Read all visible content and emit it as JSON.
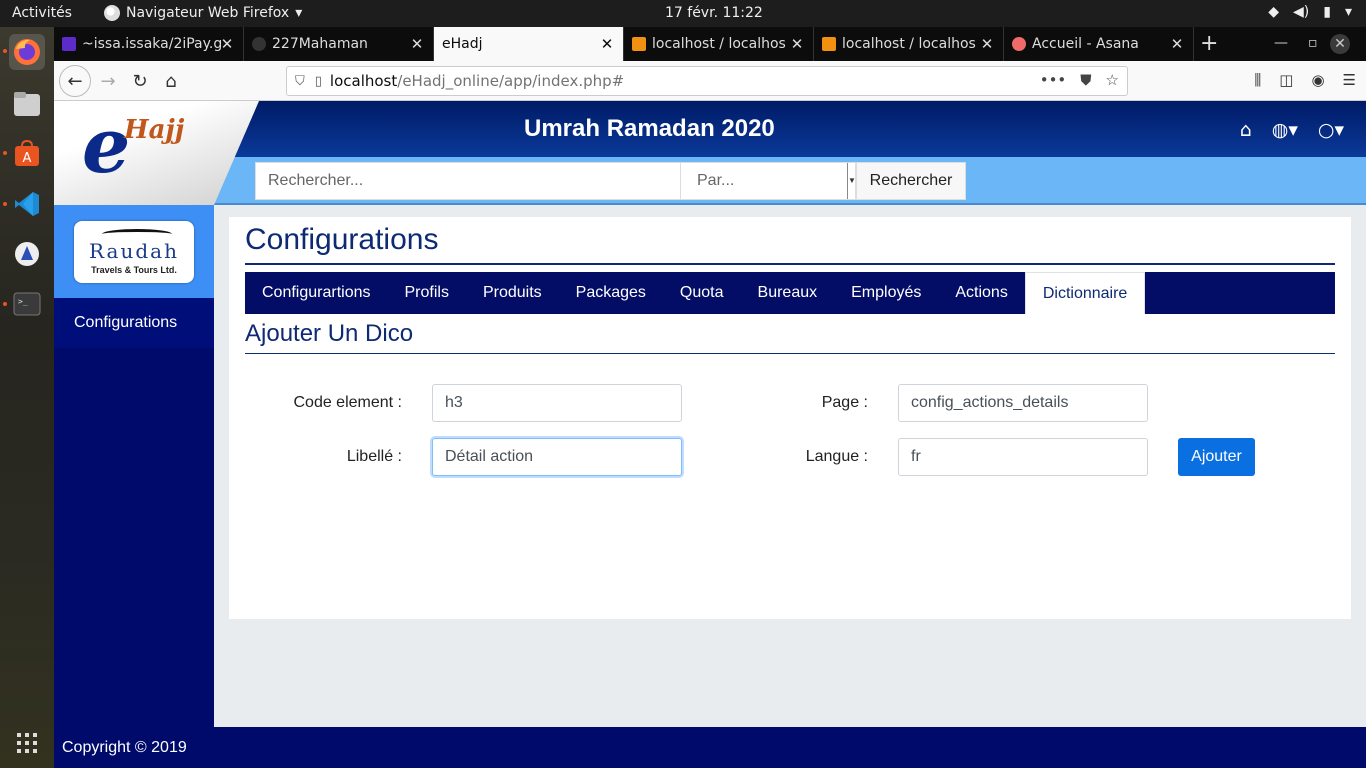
{
  "system": {
    "activities": "Activités",
    "app_menu": "Navigateur Web Firefox",
    "clock": "17 févr.  11:22"
  },
  "browser": {
    "tabs": [
      {
        "title": "~issa.issaka/2iPay.g",
        "favicon_color": "#5b2cc9"
      },
      {
        "title": "227Mahaman",
        "favicon_color": "#333333"
      },
      {
        "title": "eHadj",
        "favicon_color": ""
      },
      {
        "title": "localhost / localhos",
        "favicon_color": "#f29111"
      },
      {
        "title": "localhost / localhos",
        "favicon_color": "#f29111"
      },
      {
        "title": "Accueil - Asana",
        "favicon_color": "#f06a6a"
      }
    ],
    "url_host": "localhost",
    "url_path": "/eHadj_online/app/index.php#"
  },
  "app": {
    "logo_e": "e",
    "logo_hajj": "Hajj",
    "title": "Umrah Ramadan 2020",
    "search_placeholder": "Rechercher...",
    "search_by": "Par...",
    "search_button": "Rechercher",
    "brand_name": "Raudah",
    "brand_sub": "Travels & Tours Ltd.",
    "sidebar_items": [
      "Configurations"
    ],
    "footer": "Copyright © 2019"
  },
  "main": {
    "title": "Configurations",
    "tabs": [
      "Configurartions",
      "Profils",
      "Produits",
      "Packages",
      "Quota",
      "Bureaux",
      "Employés",
      "Actions",
      "Dictionnaire"
    ],
    "active_tab": "Dictionnaire",
    "section_title": "Ajouter Un Dico",
    "form": {
      "code_label": "Code element :",
      "code_value": "h3",
      "page_label": "Page :",
      "page_value": "config_actions_details",
      "libelle_label": "Libellé :",
      "libelle_value": "Détail action",
      "langue_label": "Langue :",
      "langue_value": "fr",
      "submit": "Ajouter"
    }
  },
  "colors": {
    "header_blue": "#001a66",
    "search_band": "#6bb6f7",
    "sidebar_navy": "#000a6a",
    "primary_button": "#0a6fe0"
  }
}
